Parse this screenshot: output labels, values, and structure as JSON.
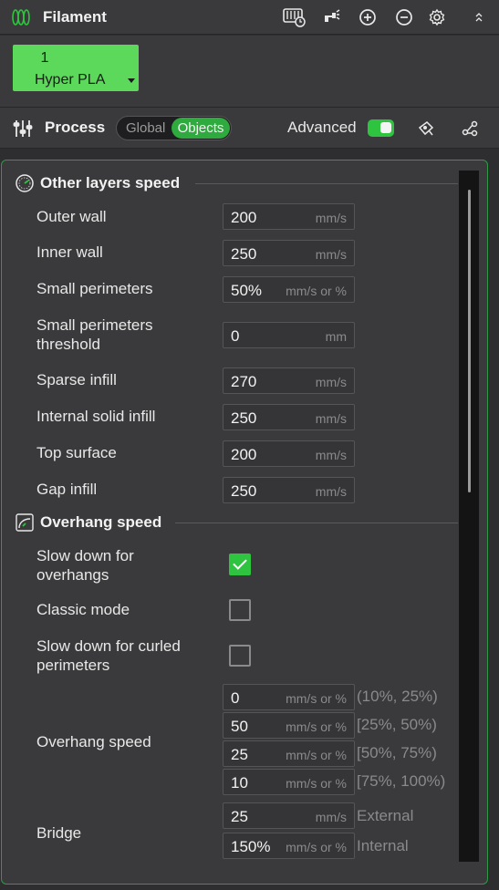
{
  "filament": {
    "title": "Filament",
    "slot": {
      "number": "1",
      "name": "Hyper PLA"
    },
    "icons": [
      "filament-icon",
      "calibration-icon",
      "spray-icon",
      "add-icon",
      "remove-icon",
      "settings-icon",
      "collapse-icon"
    ]
  },
  "process": {
    "title": "Process",
    "mode_global": "Global",
    "mode_objects": "Objects",
    "advanced_label": "Advanced",
    "advanced_on": true,
    "icons": [
      "process-icon",
      "bubble-icon",
      "compare-icon"
    ]
  },
  "colors": {
    "accent": "#2fc43f",
    "panel_bg": "#3a3a3c",
    "field_border": "#555557",
    "muted": "#8a8a8c"
  },
  "sections": {
    "other_layers": {
      "title": "Other layers speed",
      "rows": [
        {
          "label": "Outer wall",
          "value": "200",
          "unit": "mm/s"
        },
        {
          "label": "Inner wall",
          "value": "250",
          "unit": "mm/s"
        },
        {
          "label": "Small perimeters",
          "value": "50%",
          "unit": "mm/s or %"
        },
        {
          "label_line1": "Small perimeters",
          "label_line2": "threshold",
          "value": "0",
          "unit": "mm"
        },
        {
          "label": "Sparse infill",
          "value": "270",
          "unit": "mm/s"
        },
        {
          "label": "Internal solid infill",
          "value": "250",
          "unit": "mm/s"
        },
        {
          "label": "Top surface",
          "value": "200",
          "unit": "mm/s"
        },
        {
          "label": "Gap infill",
          "value": "250",
          "unit": "mm/s"
        }
      ]
    },
    "overhang": {
      "title": "Overhang speed",
      "slow_down": {
        "line1": "Slow down for",
        "line2": "overhangs",
        "checked": true
      },
      "classic_mode": {
        "label": "Classic mode",
        "checked": false
      },
      "curled": {
        "line1": "Slow down for curled",
        "line2": "perimeters",
        "checked": false
      },
      "overhang_speed": {
        "label": "Overhang speed",
        "rows": [
          {
            "value": "0",
            "unit": "mm/s or %",
            "range": "(10%, 25%)"
          },
          {
            "value": "50",
            "unit": "mm/s or %",
            "range": "[25%, 50%)"
          },
          {
            "value": "25",
            "unit": "mm/s or %",
            "range": "[50%, 75%)"
          },
          {
            "value": "10",
            "unit": "mm/s or %",
            "range": "[75%, 100%)"
          }
        ]
      },
      "bridge": {
        "label": "Bridge",
        "external": {
          "value": "25",
          "unit": "mm/s",
          "suffix": "External"
        },
        "internal": {
          "value": "150%",
          "unit": "mm/s or %",
          "suffix": "Internal"
        }
      }
    }
  }
}
